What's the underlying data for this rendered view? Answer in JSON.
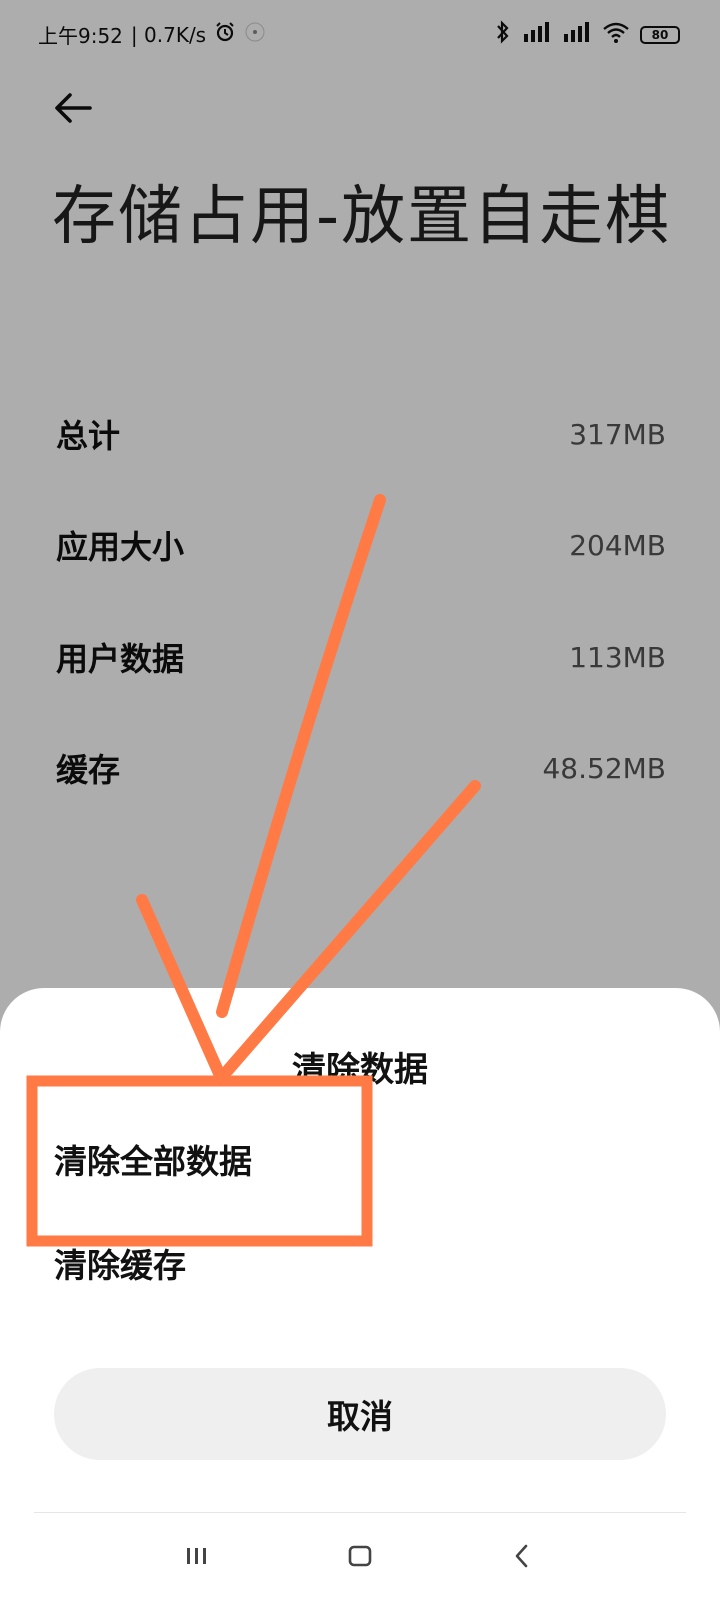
{
  "status_bar": {
    "time": "上午9:52",
    "net_speed": "| 0.7K/s",
    "battery_level": "80",
    "icons": [
      "alarm-icon",
      "notification-dot-icon",
      "bluetooth-icon",
      "hd-signal-icon-1",
      "hd-signal-icon-2",
      "wifi-icon",
      "battery-icon"
    ]
  },
  "page": {
    "title": "存储占用-放置自走棋",
    "back_icon": "arrow-left-icon",
    "rows": [
      {
        "label": "总计",
        "value": "317MB"
      },
      {
        "label": "应用大小",
        "value": "204MB"
      },
      {
        "label": "用户数据",
        "value": "113MB"
      },
      {
        "label": "缓存",
        "value": "48.52MB"
      }
    ]
  },
  "sheet": {
    "title": "清除数据",
    "options": [
      {
        "label": "清除全部数据"
      },
      {
        "label": "清除缓存"
      }
    ],
    "cancel_label": "取消"
  },
  "nav_bar": {
    "icons": [
      "menu-icon",
      "home-icon",
      "back-icon"
    ]
  },
  "colors": {
    "scrim": "#000000",
    "annotation": "#FF7A45",
    "sheet_bg": "#FFFFFF",
    "cancel_bg": "#EFEFEF"
  }
}
